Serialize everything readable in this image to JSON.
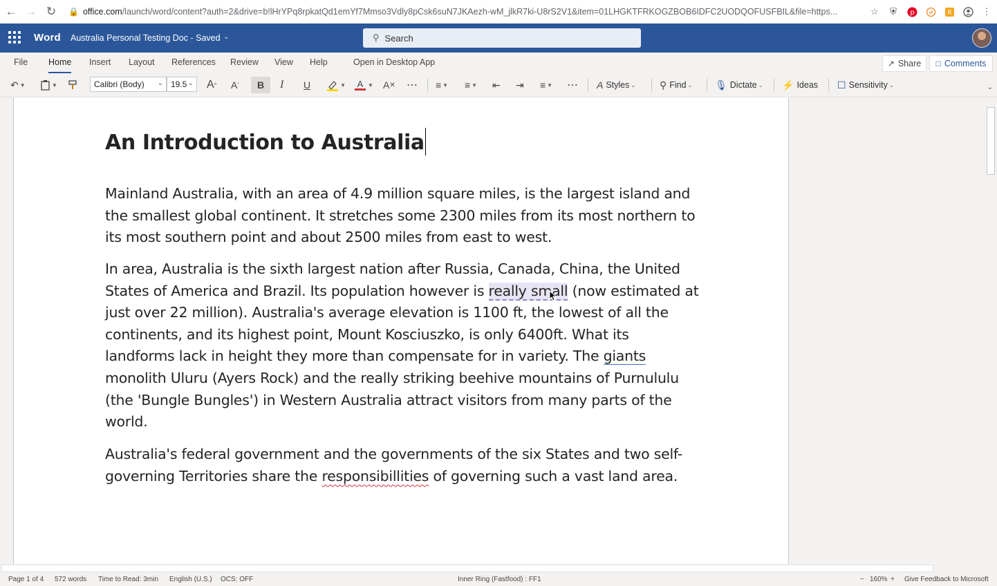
{
  "browser": {
    "url_host": "office.com",
    "url_rest": "/launch/word/content?auth=2&drive=b!lHrYPq8rpkatQd1emYf7Mmso3Vdly8pCsk6suN7JKAezh-wM_jlkR7ki-U8rS2V1&item=01LHGKTFRKOGZBOB6IDFC2UODQOFUSFBIL&file=https..."
  },
  "header": {
    "app_name": "Word",
    "doc_name": "Australia Personal Testing Doc",
    "save_status": "Saved",
    "doc_label": "Australia Personal Testing Doc - Saved",
    "search_placeholder": "Search"
  },
  "tabs": [
    "File",
    "Home",
    "Insert",
    "Layout",
    "References",
    "Review",
    "View",
    "Help",
    "Open in Desktop App"
  ],
  "tab_buttons": {
    "share": "Share",
    "comments": "Comments"
  },
  "toolbar": {
    "font_name": "Calibri (Body)",
    "font_size": "19.5",
    "styles_label": "Styles",
    "find_label": "Find",
    "dictate_label": "Dictate",
    "ideas_label": "Ideas",
    "sensitivity_label": "Sensitivity"
  },
  "document": {
    "title": "An Introduction to Australia",
    "p1": "Mainland Australia, with an area of 4.9 million square miles, is the largest island and the smallest global continent. It stretches some 2300 miles from its most northern to its most southern point   and about 2500 miles from east to west.",
    "p2_a": "In area, Australia is the sixth largest nation after Russia, Canada, China, the United States of America and Brazil. Its population however is ",
    "p2_hl": "really small",
    "p2_b": " (now estimated at just over 22 million). Australia's average elevation is 1100 ft, the lowest of all the continents, and its highest point, Mount Kosciuszko, is only 6400ft. What its landforms lack in height they more than compensate for in variety. The ",
    "p2_ul": "giants",
    "p2_c": " monolith Uluru (Ayers Rock) and the really striking beehive mountains of Purnululu (the 'Bungle Bungles') in Western Australia attract visitors from many parts of the world.",
    "p3_a": "Australia's federal government and the governments of the six States and two self-governing Territories share the ",
    "p3_err": "responsibillities",
    "p3_b": " of governing such a vast land area."
  },
  "status": {
    "page": "Page 1 of 4",
    "words": "572 words",
    "read_time": "Time to Read: 3min",
    "language": "English (U.S.)",
    "ocs": "OCS: OFF",
    "ring": "Inner Ring (Fastfood) : FF1",
    "zoom": "160%",
    "feedback": "Give Feedback to Microsoft"
  },
  "colors": {
    "word_blue": "#2b579a",
    "highlight": "#e8e4f3",
    "font_color_red": "#d13438",
    "highlighter_yellow": "#ffd800"
  }
}
